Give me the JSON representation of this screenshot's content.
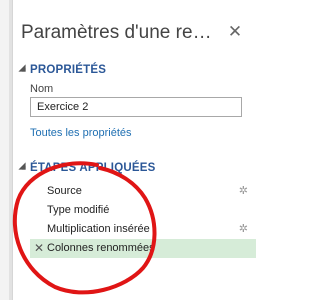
{
  "pane": {
    "title": "Paramètres d'une requ...",
    "close_glyph": "✕"
  },
  "properties": {
    "header": "PROPRIÉTÉS",
    "name_label": "Nom",
    "name_value": "Exercice 2",
    "all_properties_link": "Toutes les propriétés"
  },
  "applied_steps": {
    "header": "ÉTAPES APPLIQUÉES",
    "steps": [
      {
        "label": "Source",
        "has_gear": true,
        "selected": false
      },
      {
        "label": "Type modifié",
        "has_gear": false,
        "selected": false
      },
      {
        "label": "Multiplication insérée",
        "has_gear": true,
        "selected": false
      },
      {
        "label": "Colonnes renommées",
        "has_gear": false,
        "selected": true
      }
    ],
    "delete_glyph": "✕",
    "gear_glyph": "✲"
  },
  "colors": {
    "section_header": "#2b5797",
    "link": "#1f6fb2",
    "selected_row": "#d6ecd8",
    "annotation": "#e01515"
  }
}
